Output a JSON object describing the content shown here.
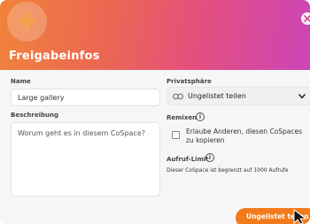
{
  "dialog": {
    "title": "Freigabeinfos",
    "icons": {
      "logo": "plus-icon",
      "close": "close-icon"
    }
  },
  "name": {
    "label": "Name",
    "value": "Large gallery"
  },
  "description": {
    "label": "Beschreibung",
    "placeholder": "Worum geht es in diesem CoSpace?"
  },
  "privacy": {
    "label": "Privatsphäre",
    "selected": "Ungelistet teilen",
    "icons": {
      "prefix": "link-icon",
      "dropdown": "chevron-down-icon"
    }
  },
  "remix": {
    "label": "Remixen",
    "checkbox_label": "Erlaube Anderen, diesen CoSpaces zu kopieren",
    "checked": false
  },
  "call_limit": {
    "label": "Aufruf-Limit",
    "text": "Dieser CoSpace ist begrenzt auf 1000 Aufrufe"
  },
  "footer": {
    "button_label": "Ungelistet teilen"
  },
  "colors": {
    "accent": "#f27a1a",
    "header_gradient": [
      "#f0833a",
      "#e24f80",
      "#cc45b8"
    ]
  }
}
